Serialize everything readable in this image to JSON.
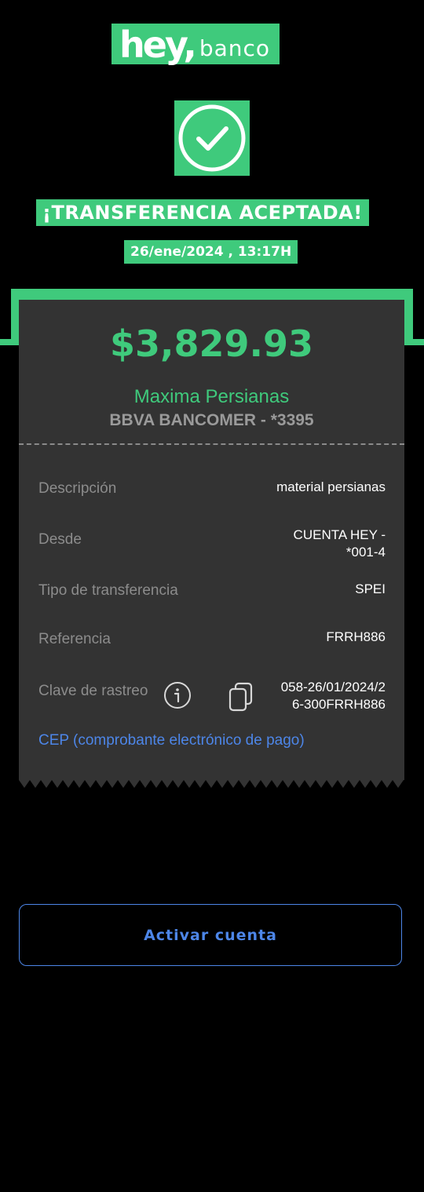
{
  "brand": {
    "logo_main": "hey,",
    "logo_sub": "banco"
  },
  "status": {
    "title": "¡TRANSFERENCIA ACEPTADA!",
    "datetime": "26/ene/2024 , 13:17H",
    "icon": "check-circle-icon"
  },
  "receipt": {
    "amount": "$3,829.93",
    "recipient_name": "Maxima Persianas",
    "recipient_bank": "BBVA BANCOMER - *3395",
    "rows": [
      {
        "label": "Descripción",
        "value": "material persianas"
      },
      {
        "label": "Desde",
        "value_line1": "CUENTA HEY -",
        "value_line2": "*001-4"
      },
      {
        "label": "Tipo de transferencia",
        "value": "SPEI"
      },
      {
        "label": "Referencia",
        "value": "FRRH886"
      },
      {
        "label": "Clave de rastreo",
        "value_line1": "058-26/01/2024/2",
        "value_line2": "6-300FRRH886"
      }
    ],
    "cep_link": "CEP (comprobante electrónico de pago)"
  },
  "actions": {
    "activate_label": "Activar cuenta"
  },
  "colors": {
    "accent_green": "#3fca7c",
    "link_blue": "#4d86e8",
    "ticket_bg": "#333333",
    "page_bg": "#000000"
  }
}
